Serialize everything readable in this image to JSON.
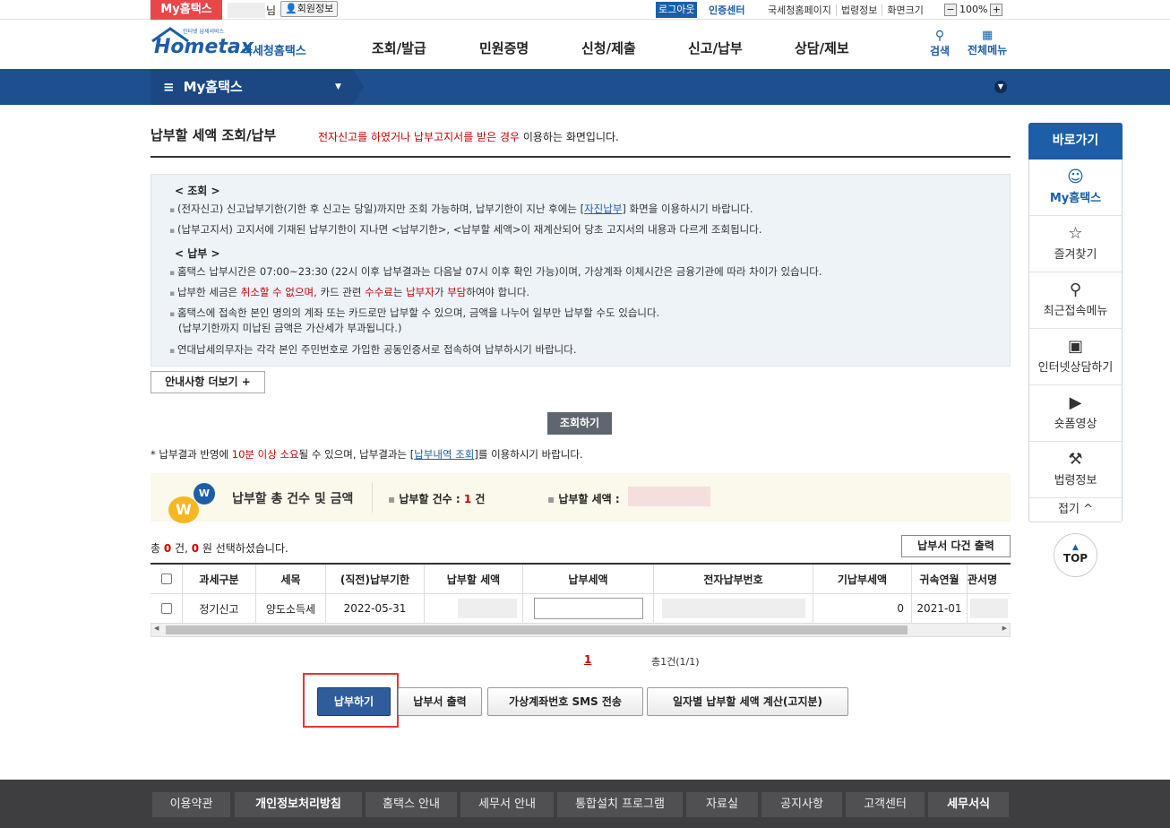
{
  "util": {
    "my_hometax": "My홈택스",
    "nim": "님",
    "member": "회원정보",
    "logout": "로그아웃",
    "cert": "인증센터",
    "links": [
      "국세청홈페이지",
      "법령정보",
      "화면크기"
    ],
    "zoom": "100%",
    "zoom_minus": "−",
    "zoom_plus": "+"
  },
  "logo": {
    "small": "인터넷 납세서비스",
    "main": "Hometax",
    "kr": "국세청홈택스"
  },
  "gnb": [
    "조회/발급",
    "민원증명",
    "신청/제출",
    "신고/납부",
    "상담/제보"
  ],
  "header": {
    "search": "검색",
    "allmenu": "전체메뉴"
  },
  "bar": {
    "label": "My홈택스",
    "menu_icon": "≡"
  },
  "page": {
    "title": "납부할 세액 조회/납부",
    "sub_red": "전자신고를 하였거나 납부고지서를 받은 경우",
    "sub_rest": " 이용하는 화면입니다."
  },
  "info": {
    "h1": "< 조회 >",
    "l1a": "(전자신고) 신고납부기한(기한 후 신고는 당일)까지만 조회 가능하며, 납부기한이 지난 후에는 [",
    "l1link": "자진납부",
    "l1b": "] 화면을 이용하시기 바랍니다.",
    "l2": "(납부고지서) 고지서에 기재된 납부기한이 지나면 <납부기한>, <납부할 세액>이 재계산되어 당초 고지서의 내용과 다르게 조회됩니다.",
    "h2": "< 납부 >",
    "l3": "홈택스 납부시간은 07:00~23:30 (22시 이후 납부결과는 다음날 07시 이후 확인 가능)이며, 가상계좌 이체시간은 금융기관에 따라 차이가 있습니다.",
    "l4a": "납부한 세금은 ",
    "l4r1": "취소할 수 없으며,",
    "l4b": " 카드 관련 ",
    "l4r2": "수수료",
    "l4c": "는 ",
    "l4r3": "납부자",
    "l4d": "가 ",
    "l4r4": "부담",
    "l4e": "하여야 합니다.",
    "l5": "홈택스에 접속한 본인 명의의 계좌 또는 카드로만 납부할 수 있으며, 금액을 나누어 일부만 납부할 수도 있습니다.",
    "l5b": "(납부기한까지 미납된 금액은 가산세가 부과됩니다.)",
    "l6": "연대납세의무자는 각각 본인 주민번호로 가입한 공동인증서로 접속하여 납부하시기 바랍니다."
  },
  "more_btn": "안내사항 더보기 +",
  "query_btn": "조회하기",
  "note": {
    "a": "* 납부결과 반영에 ",
    "r": "10분 이상 소요",
    "b": "될 수 있으며, 납부결과는 [",
    "link": "납부내역 조회",
    "c": "]를 이용하시기 바랍니다."
  },
  "summary": {
    "title": "납부할 총 건수 및 금액",
    "count_label": "납부할 건수 : ",
    "count": "1",
    "count_unit": " 건",
    "amount_label": "납부할 세액 : ",
    "badge1": "W",
    "badge2": "W"
  },
  "select": {
    "a": "총 ",
    "n1": "0",
    "b": " 건, ",
    "n2": "0",
    "c": " 원 선택하셨습니다."
  },
  "multi_print": "납부서 다건 출력",
  "table": {
    "headers": [
      "과세구분",
      "세목",
      "(직전)납부기한",
      "납부할 세액",
      "납부세액",
      "전자납부번호",
      "기납부세액",
      "귀속연월",
      "관서명"
    ],
    "row": {
      "type": "정기신고",
      "tax": "양도소득세",
      "deadline": "2022-05-31",
      "paid": "0",
      "period": "2021-01"
    }
  },
  "scroll": {
    "left": "◀",
    "right": "▶"
  },
  "paging": {
    "page": "1",
    "total": "총1건(1/1)"
  },
  "buttons": {
    "pay": "납부하기",
    "print": "납부서 출력",
    "sms": "가상계좌번호 SMS 전송",
    "calc": "일자별 납부할 세액 계산(고지분)"
  },
  "footer": [
    "이용약관",
    "개인정보처리방침",
    "홈택스 안내",
    "세무서 안내",
    "통합설치 프로그램",
    "자료실",
    "공지사항",
    "고객센터",
    "세무서식"
  ],
  "quick": {
    "title": "바로가기",
    "items": [
      "My홈택스",
      "즐겨찾기",
      "최근접속메뉴",
      "인터넷상담하기",
      "숏폼영상",
      "법령정보"
    ],
    "fold": "접기 ^",
    "top": "TOP",
    "top_arrow": "▲"
  },
  "colors": {
    "accent": "#1c5ea8",
    "red": "#cc0000",
    "bar": "#1e4f8f"
  }
}
